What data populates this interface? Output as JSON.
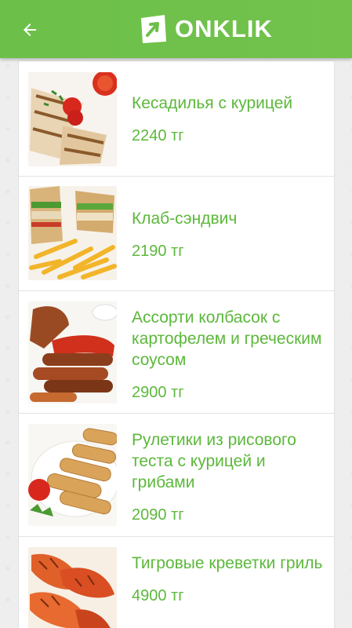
{
  "header": {
    "logo_text": "ONKLIK",
    "brand_color": "#6cc04a"
  },
  "items": [
    {
      "name": "Кесадилья с курицей",
      "price": "2240 тг"
    },
    {
      "name": "Клаб-сэндвич",
      "price": "2190 тг"
    },
    {
      "name": "Ассорти колбасок с картофелем и греческим соусом",
      "price": "2900 тг"
    },
    {
      "name": "Рулетики из рисового теста с курицей и грибами",
      "price": "2090 тг"
    },
    {
      "name": "Тигровые креветки гриль",
      "price": "4900 тг"
    }
  ]
}
